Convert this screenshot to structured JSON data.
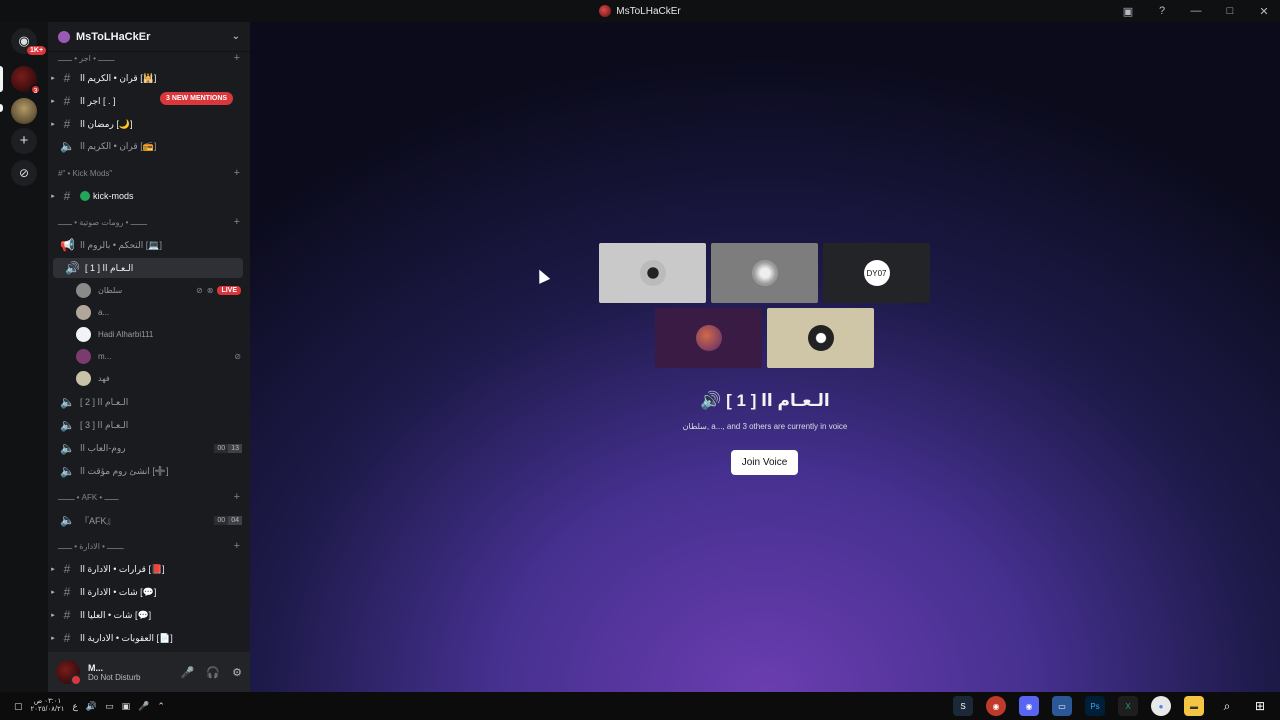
{
  "window": {
    "title": "MsToLHaCkEr"
  },
  "guilds": {
    "home_badge": "1K+",
    "g1_badge": "3"
  },
  "server": {
    "name": "MsToLHaCkEr",
    "mentions": "3 NEW MENTIONS"
  },
  "channels": [
    {
      "label": "قران • الكريم اا [🕌]"
    },
    {
      "label": "اجر اا [ . ]"
    },
    {
      "label": "رمضان اا [🌙]"
    },
    {
      "label": "قران • الكريم اا [📻]"
    }
  ],
  "categories": {
    "kick": "#\" • Kick Mods\"",
    "voice": "ـــــــ • رومات صوتية • ــــــ",
    "afk": "ـــــــ • AFK • ــــــ",
    "admin": "ـــــــ • الادارة • ــــــ",
    "top": "ـــــــ • اجر • ــــــ"
  },
  "kick_channel": "kick-mods",
  "voice_channels": {
    "control": "التحكم • بالروم اا [💻]",
    "active": "الـعـام اا [ 1 ]",
    "ch2": "الـعـام اا [ 2 ]",
    "ch3": "الـعـام اا [ 3 ]",
    "games": "روم-العاب اا",
    "games_counts": [
      "00",
      "13"
    ],
    "temp": "انشئ روم مؤقت اا [➕]",
    "afk": "『AFK』",
    "afk_counts": [
      "00",
      "04"
    ]
  },
  "voice_members": [
    {
      "name": "سلطان",
      "live": "LIVE"
    },
    {
      "name": "a..."
    },
    {
      "name": "Hadi Alharbi111"
    },
    {
      "name": "m..."
    },
    {
      "name": "فهد"
    }
  ],
  "admin_channels": [
    {
      "label": "قرارات • الادارة اا [📕]"
    },
    {
      "label": "شات • الادارة اا [💬]"
    },
    {
      "label": "شات • العليا اا [💬]"
    },
    {
      "label": "العقوبات • الادارية اا [📄]"
    }
  ],
  "user": {
    "name": "M...",
    "status": "Do Not Disturb"
  },
  "voice_view": {
    "title": "الـعـام اا [ 1 ]",
    "subtitle": "سلطان, a..., and 3 others are currently in voice",
    "join_label": "Join Voice",
    "tile3_text": "DY07"
  },
  "taskbar": {
    "time": "٠٣:٠١ ص",
    "date": "٢٠٢٥/٠٨/٢١",
    "lang": "ع"
  }
}
